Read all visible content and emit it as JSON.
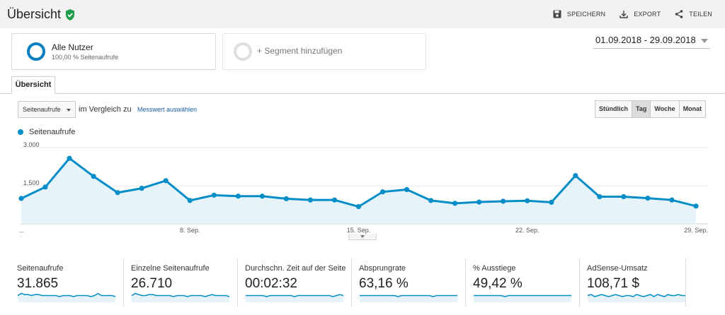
{
  "header": {
    "title": "Übersicht",
    "actions": {
      "save": "SPEICHERN",
      "export": "EXPORT",
      "share": "TEILEN"
    }
  },
  "segments": {
    "primary": {
      "name": "Alle Nutzer",
      "sub": "100,00 % Seitenaufrufe"
    },
    "add": "+ Segment hinzufügen"
  },
  "date_range": "01.09.2018 - 29.09.2018",
  "tab": "Übersicht",
  "controls": {
    "metric": "Seitenaufrufe",
    "compare_label": "im Vergleich zu",
    "choose_metric": "Messwert auswählen",
    "granularity": [
      "Stündlich",
      "Tag",
      "Woche",
      "Monat"
    ],
    "granularity_active": "Tag"
  },
  "colors": {
    "series": "#058dc7",
    "fill": "#e6f4fa",
    "accent": "#0a7fc2",
    "verified": "#1e9e4a"
  },
  "chart_data": {
    "type": "area",
    "x": [
      "01.09.",
      "02.09.",
      "03.09.",
      "04.09.",
      "05.09.",
      "06.09.",
      "07.09.",
      "08.09.",
      "09.09.",
      "10.09.",
      "11.09.",
      "12.09.",
      "13.09.",
      "14.09.",
      "15.09.",
      "16.09.",
      "17.09.",
      "18.09.",
      "19.09.",
      "20.09.",
      "21.09.",
      "22.09.",
      "23.09.",
      "24.09.",
      "25.09.",
      "26.09.",
      "27.09.",
      "28.09.",
      "29.09."
    ],
    "series": [
      {
        "name": "Seitenaufrufe",
        "values": [
          1000,
          1450,
          2580,
          1870,
          1230,
          1400,
          1700,
          920,
          1130,
          1090,
          1090,
          990,
          940,
          940,
          680,
          1260,
          1350,
          920,
          810,
          860,
          890,
          910,
          850,
          1900,
          1070,
          1070,
          1010,
          940,
          700
        ]
      }
    ],
    "y_ticks": [
      "3.000",
      "1.500"
    ],
    "x_ticks": [
      "...",
      "8. Sep.",
      "15. Sep.",
      "22. Sep.",
      "29. Sep."
    ],
    "ylim": [
      0,
      3000
    ],
    "grid": true
  },
  "scorecards": [
    {
      "label": "Seitenaufrufe",
      "value": "31.865",
      "spark": [
        5,
        7,
        6,
        6,
        5,
        6,
        6,
        5,
        5,
        5,
        5,
        5,
        4,
        5,
        5,
        5,
        4,
        5,
        5,
        5,
        5,
        4,
        5,
        7,
        5,
        5,
        5,
        5,
        4
      ]
    },
    {
      "label": "Einzelne Seitenaufrufe",
      "value": "26.710",
      "spark": [
        5,
        7,
        6,
        5,
        5,
        6,
        6,
        5,
        5,
        5,
        5,
        5,
        4,
        5,
        5,
        5,
        4,
        5,
        5,
        5,
        5,
        4,
        5,
        6,
        5,
        5,
        5,
        5,
        4
      ]
    },
    {
      "label": "Durchschn. Zeit auf der Seite",
      "value": "00:02:32",
      "spark": [
        5,
        5,
        5,
        5,
        5,
        5,
        4,
        5,
        5,
        5,
        5,
        5,
        5,
        5,
        4,
        5,
        5,
        5,
        5,
        5,
        5,
        5,
        5,
        5,
        5,
        4,
        5,
        6,
        5
      ]
    },
    {
      "label": "Absprungrate",
      "value": "63,16 %",
      "spark": [
        5,
        5,
        5,
        5,
        5,
        5,
        5,
        5,
        5,
        5,
        5,
        4,
        5,
        5,
        5,
        5,
        5,
        5,
        5,
        5,
        5,
        4,
        5,
        5,
        5,
        5,
        5,
        5,
        5
      ]
    },
    {
      "label": "% Ausstiege",
      "value": "49,42 %",
      "spark": [
        5,
        5,
        5,
        5,
        5,
        5,
        5,
        5,
        5,
        4,
        5,
        5,
        5,
        5,
        5,
        5,
        5,
        5,
        5,
        5,
        5,
        5,
        5,
        5,
        5,
        5,
        5,
        5,
        5
      ]
    },
    {
      "label": "AdSense-Umsatz",
      "value": "108,71 $",
      "spark": [
        5,
        6,
        4,
        5,
        6,
        5,
        4,
        5,
        6,
        5,
        4,
        5,
        5,
        4,
        6,
        5,
        4,
        5,
        6,
        4,
        6,
        5,
        4,
        6,
        5,
        5,
        6,
        5,
        5
      ]
    }
  ]
}
